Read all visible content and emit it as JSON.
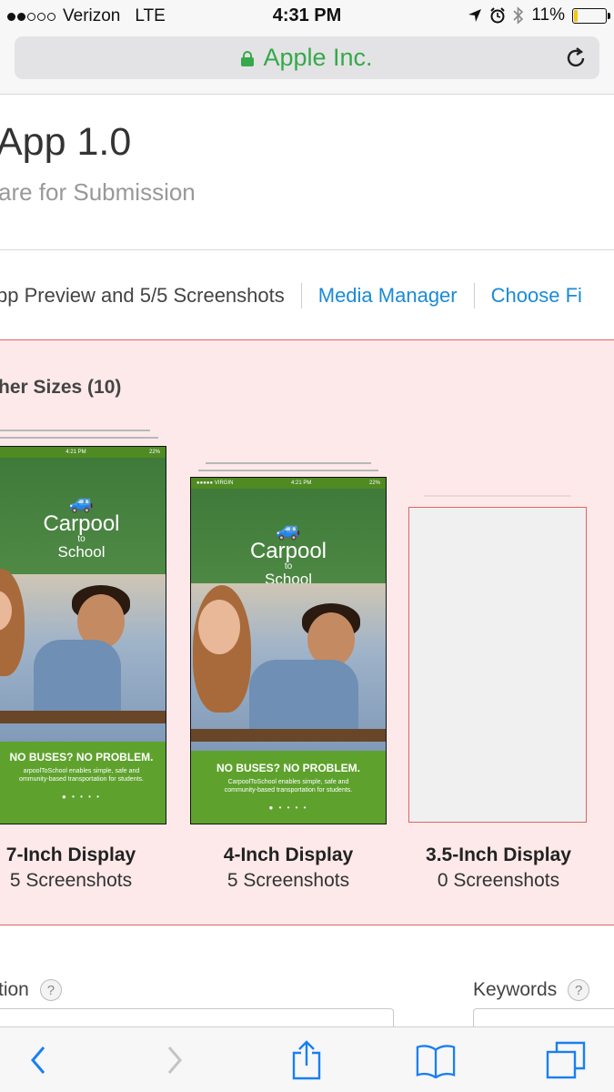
{
  "status_bar": {
    "carrier": "Verizon",
    "network": "LTE",
    "time": "4:31 PM",
    "battery_percent_label": "11%",
    "battery_level": 0.11,
    "signal_bars_filled": 2,
    "signal_bars_total": 5
  },
  "browser": {
    "site_name": "Apple Inc.",
    "secure_color": "#37a84b"
  },
  "page": {
    "title": "App 1.0",
    "subtitle": "are for Submission"
  },
  "subnav": {
    "summary": "pp Preview and 5/5 Screenshots",
    "media_manager": "Media Manager",
    "choose_file": "Choose Fi"
  },
  "screenshots": {
    "heading": "her Sizes (10)",
    "devices": [
      {
        "title": "7-Inch Display",
        "count": "5 Screenshots",
        "preview": {
          "carrier": "",
          "time": "4:21 PM",
          "battery": "22%",
          "app_name_1": "Carpool",
          "app_name_2": "to",
          "app_name_3": "School",
          "headline": "NO BUSES? NO PROBLEM.",
          "tagline_1": "arpoolToSchool enables simple, safe and",
          "tagline_2": "ommunity-based transportation for students.",
          "dots": "● • • • •"
        }
      },
      {
        "title": "4-Inch Display",
        "count": "5 Screenshots",
        "preview": {
          "carrier": "●●●●● VIRGIN",
          "time": "4:21 PM",
          "battery": "22%",
          "app_name_1": "Carpool",
          "app_name_2": "to",
          "app_name_3": "School",
          "headline": "NO BUSES? NO PROBLEM.",
          "tagline_1": "CarpoolToSchool enables simple, safe and",
          "tagline_2": "community-based transportation for students.",
          "dots": "● • • • •"
        }
      },
      {
        "title": "3.5-Inch Display",
        "count": "0 Screenshots"
      }
    ]
  },
  "fields": {
    "left_label": "tion",
    "right_label": "Keywords",
    "help_glyph": "?"
  },
  "colors": {
    "link": "#1a8bd6",
    "error_border": "#e06464",
    "panel_bg": "#fde9e9",
    "toolbar_icon": "#1a7ff0"
  }
}
